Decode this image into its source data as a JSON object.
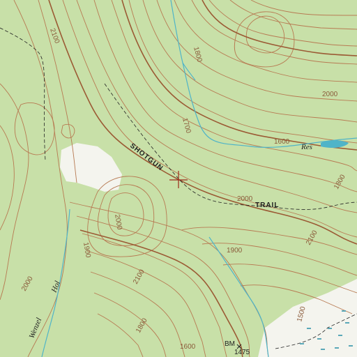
{
  "map": {
    "colors": {
      "vegetation": "#c8e0a8",
      "clearing": "#f4f4ee",
      "contour": "#b77a52",
      "index_contour": "#9b5a34",
      "water": "#4fb4c8",
      "road": "#222222",
      "marsh": "#5aa8b8"
    },
    "labels": {
      "e_2100_top": "2100",
      "e_1800_top": "1800",
      "e_2000_ne": "2000",
      "e_1700": "1700",
      "e_1600": "1600",
      "e_2000_mid": "2000",
      "e_1800_e": "1800",
      "e_2100_e": "2100",
      "e_2000_w": "2000",
      "e_1900_s": "1900",
      "e_1900_w": "1900",
      "e_2000_sw": "2000",
      "e_2100_sw": "2100",
      "e_1800_sw": "1800",
      "e_1600_s": "1600",
      "e_1500": "1500",
      "res": "Res",
      "shotgun": "SHOTGUN",
      "trail": "TRAIL",
      "wenzel": "Wenzel",
      "hol": "Hol",
      "bm": "BM",
      "bm_elev": "1475"
    },
    "landmark_symbol": "crosshair-marker"
  }
}
